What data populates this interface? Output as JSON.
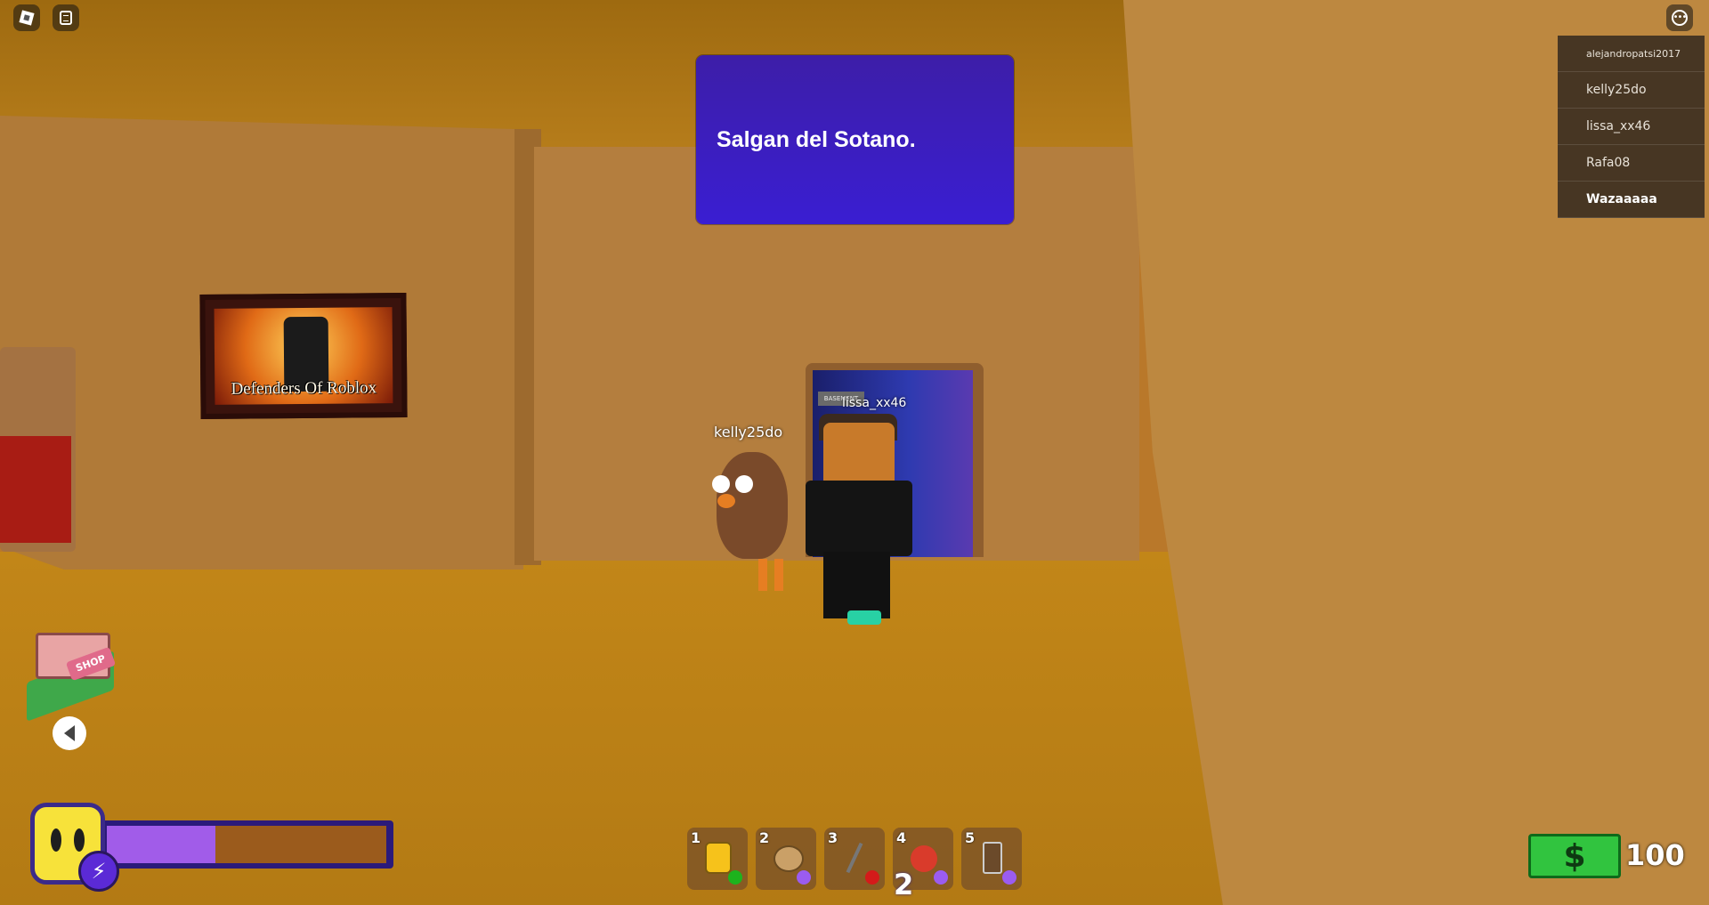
{
  "message": {
    "text": "Salgan del Sotano."
  },
  "player_list": [
    {
      "name": "alejandropatsi2017"
    },
    {
      "name": "kelly25do"
    },
    {
      "name": "lissa_xx46"
    },
    {
      "name": "Rafa08"
    },
    {
      "name": "Wazaaaaa"
    }
  ],
  "scene": {
    "poster_title": "Defenders Of Roblox",
    "door_sign": "BASEMENT",
    "nametag_turkey": "kelly25do",
    "nametag_avatar": "lissa_xx46"
  },
  "shop": {
    "sign": "SHOP"
  },
  "energy": {
    "level": 0.39
  },
  "hotbar": {
    "slots": [
      {
        "number": "1",
        "item_icon": "honey-jar-icon",
        "dot_color": "#1db31d"
      },
      {
        "number": "2",
        "item_icon": "cookie-icon",
        "dot_color": "#9b5cf0"
      },
      {
        "number": "3",
        "item_icon": "pitchfork-icon",
        "dot_color": "#d41a1a"
      },
      {
        "number": "4",
        "item_icon": "apple-icon",
        "dot_color": "#9b5cf0"
      },
      {
        "number": "5",
        "item_icon": "cup-icon",
        "dot_color": "#9b5cf0"
      }
    ],
    "stack_count": "2"
  },
  "cash": {
    "amount": "100"
  },
  "colors": {
    "message_box": "#3a1ed2",
    "energy_fill": "#a15ce9",
    "cash_green": "#31c43f"
  }
}
